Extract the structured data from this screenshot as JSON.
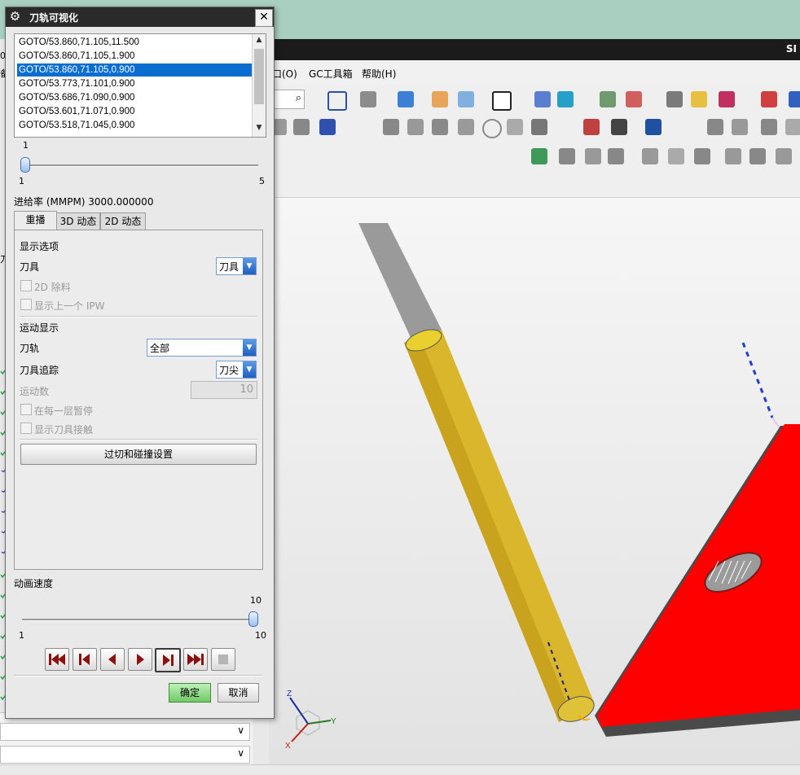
{
  "app": {
    "title_fragment": "SI",
    "menus": [
      "口(O)",
      "GC工具箱",
      "帮助(H)"
    ],
    "left_partial_labels": [
      "0",
      "备",
      "刀"
    ]
  },
  "dialog": {
    "title": "刀轨可视化",
    "close_label": "✕",
    "commands": [
      "GOTO/53.860,71.105,11.500",
      "GOTO/53.860,71.105,1.900",
      "GOTO/53.860,71.105,0.900",
      "GOTO/53.773,71.101,0.900",
      "GOTO/53.686,71.090,0.900",
      "GOTO/53.601,71.071,0.900",
      "GOTO/53.518,71.045,0.900"
    ],
    "selected_command_index": 2,
    "step_slider": {
      "current_label": "1",
      "min_label": "1",
      "max_label": "5",
      "value": 1,
      "min": 1,
      "max": 5
    },
    "feed_rate_label": "进给率 (MMPM) 3000.000000",
    "tabs": [
      "重播",
      "3D 动态",
      "2D 动态"
    ],
    "active_tab": 0,
    "display_options": {
      "section_label": "显示选项",
      "tool_label": "刀具",
      "tool_value": "刀具",
      "remove_2d_label": "2D 除料",
      "show_prev_ipw_label": "显示上一个 IPW"
    },
    "motion_display": {
      "section_label": "运动显示",
      "path_label": "刀轨",
      "path_value": "全部",
      "tool_trace_label": "刀具追踪",
      "tool_trace_value": "刀尖",
      "motion_count_label": "运动数",
      "motion_count_value": "10",
      "pause_each_layer_label": "在每一层暂停",
      "show_tool_contact_label": "显示刀具接触"
    },
    "collision_button_label": "过切和碰撞设置",
    "animation_speed": {
      "label": "动画速度",
      "current_label": "10",
      "min_label": "1",
      "max_label": "10",
      "value": 10,
      "min": 1,
      "max": 10
    },
    "playback_icons": [
      "rewind-to-start-icon",
      "step-back-icon",
      "play-reverse-icon",
      "play-forward-icon",
      "step-forward-icon",
      "fast-forward-to-end-icon",
      "stop-icon"
    ],
    "ok_label": "确定",
    "cancel_label": "取消"
  },
  "colors": {
    "selection": "#0a6ed1",
    "part_face": "#ff0000",
    "tool_body": "#d9b62c",
    "tool_holder": "#9a9a9a",
    "ok_button": "#6fc964"
  },
  "axis_labels": {
    "z": "Z",
    "y": "Y",
    "x": "X"
  }
}
